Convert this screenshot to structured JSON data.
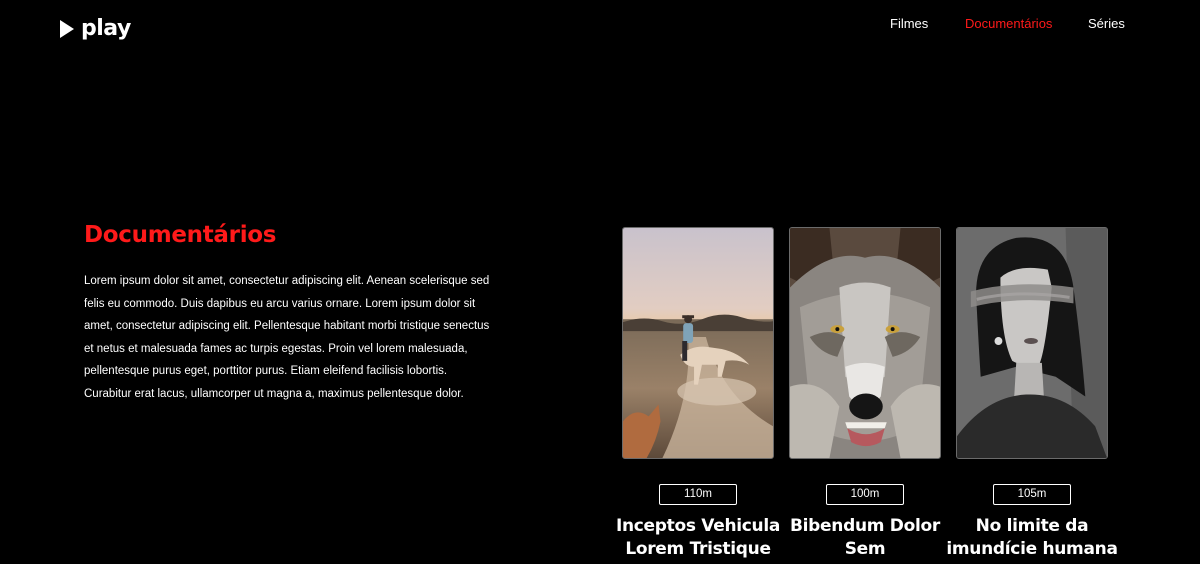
{
  "brand": {
    "name": "play",
    "icon": "play-triangle-icon"
  },
  "nav": [
    {
      "label": "Filmes",
      "active": false
    },
    {
      "label": "Documentários",
      "active": true
    },
    {
      "label": "Séries",
      "active": false
    }
  ],
  "colors": {
    "accent": "#ff1a1a",
    "background": "#000000",
    "text": "#ffffff"
  },
  "intro": {
    "heading": "Documentários",
    "body": "Lorem ipsum dolor sit amet, consectetur adipiscing elit. Aenean scelerisque sed felis eu commodo. Duis dapibus eu arcu varius ornare. Lorem ipsum dolor sit amet, consectetur adipiscing elit. Pellentesque habitant morbi tristique senectus et netus et malesuada fames ac turpis egestas. Proin vel lorem malesuada, pellentesque purus eget, porttitor purus. Etiam eleifend facilisis lobortis. Curabitur erat lacus, ullamcorper ut magna a, maximus pellentesque dolor."
  },
  "cards": [
    {
      "duration": "110m",
      "title_line1": "Inceptos Vehicula",
      "title_line2": "Lorem Tristique",
      "poster": "cowboy-on-horse-image"
    },
    {
      "duration": "100m",
      "title_line1": "Bibendum Dolor",
      "title_line2": "Sem",
      "poster": "wolf-face-image"
    },
    {
      "duration": "105m",
      "title_line1": "No limite da",
      "title_line2": "imundície humana",
      "poster": "woman-portrait-image"
    }
  ]
}
